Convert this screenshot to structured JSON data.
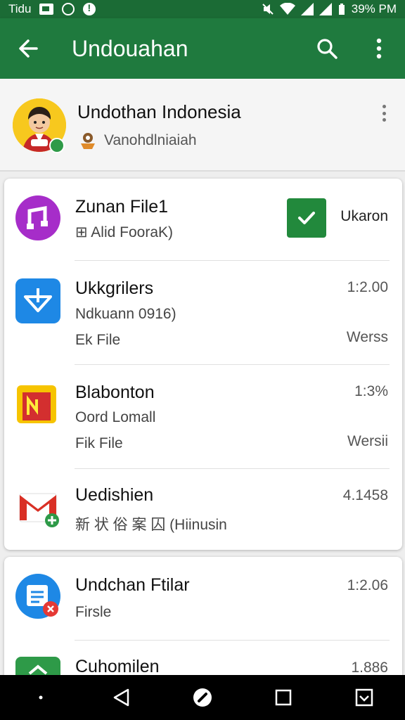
{
  "status_bar": {
    "time_label": "Tidu",
    "right_text": "39% PM",
    "icons": [
      "image-icon",
      "gear-icon",
      "alert-icon",
      "mute-icon",
      "wifi-icon",
      "signal-icon",
      "signal-icon",
      "battery-icon"
    ]
  },
  "app_bar": {
    "title": "Undouahan",
    "icons": [
      "back-arrow-icon",
      "search-icon",
      "more-vert-icon"
    ]
  },
  "header": {
    "name": "Undothan Indonesia",
    "subtitle": "Vanohdlniaiah",
    "icons": [
      "avatar",
      "small-badge-icon",
      "more-vert-icon"
    ]
  },
  "card1": {
    "items": [
      {
        "title": "Zunan File1",
        "sub1": "Alid FooraK)",
        "sub1_prefix_glyph": "⊞",
        "right_label": "Ukaron",
        "checked": true,
        "icon": "music-app-icon",
        "icon_color": "#a62dc9"
      },
      {
        "title": "Ukkgrilers",
        "sub1": "Ndkuann 0916)",
        "sub2": "Ek File",
        "right_value": "1:2.00",
        "right_label": "Werss",
        "icon": "download-app-icon",
        "icon_color": "#1e88e5"
      },
      {
        "title": "Blabonton",
        "sub1": "Oord Lomall",
        "sub2": "Fik File",
        "right_value": "1:3%",
        "right_label": "Wersii",
        "icon": "news-app-icon",
        "icon_color": "#f6c400"
      },
      {
        "title": "Uedishien",
        "sub1": "新 状 俗 案 囚 (Hiinusin",
        "right_value": "4.1458",
        "icon": "gmail-icon",
        "icon_color": "#d93025"
      }
    ]
  },
  "card2": {
    "items": [
      {
        "title": "Undchan Ftilar",
        "sub1": "Firsle",
        "right_value": "1:2.06",
        "icon": "docs-app-icon",
        "icon_color": "#1e88e5"
      },
      {
        "title": "Cuhomilen",
        "right_value": "1.886",
        "icon": "green-app-icon",
        "icon_color": "#2e9a48"
      }
    ]
  },
  "nav_bar": {
    "icons": [
      "small-dot-icon",
      "back-triangle-icon",
      "home-circle-icon",
      "recents-square-icon",
      "download-box-icon"
    ]
  }
}
